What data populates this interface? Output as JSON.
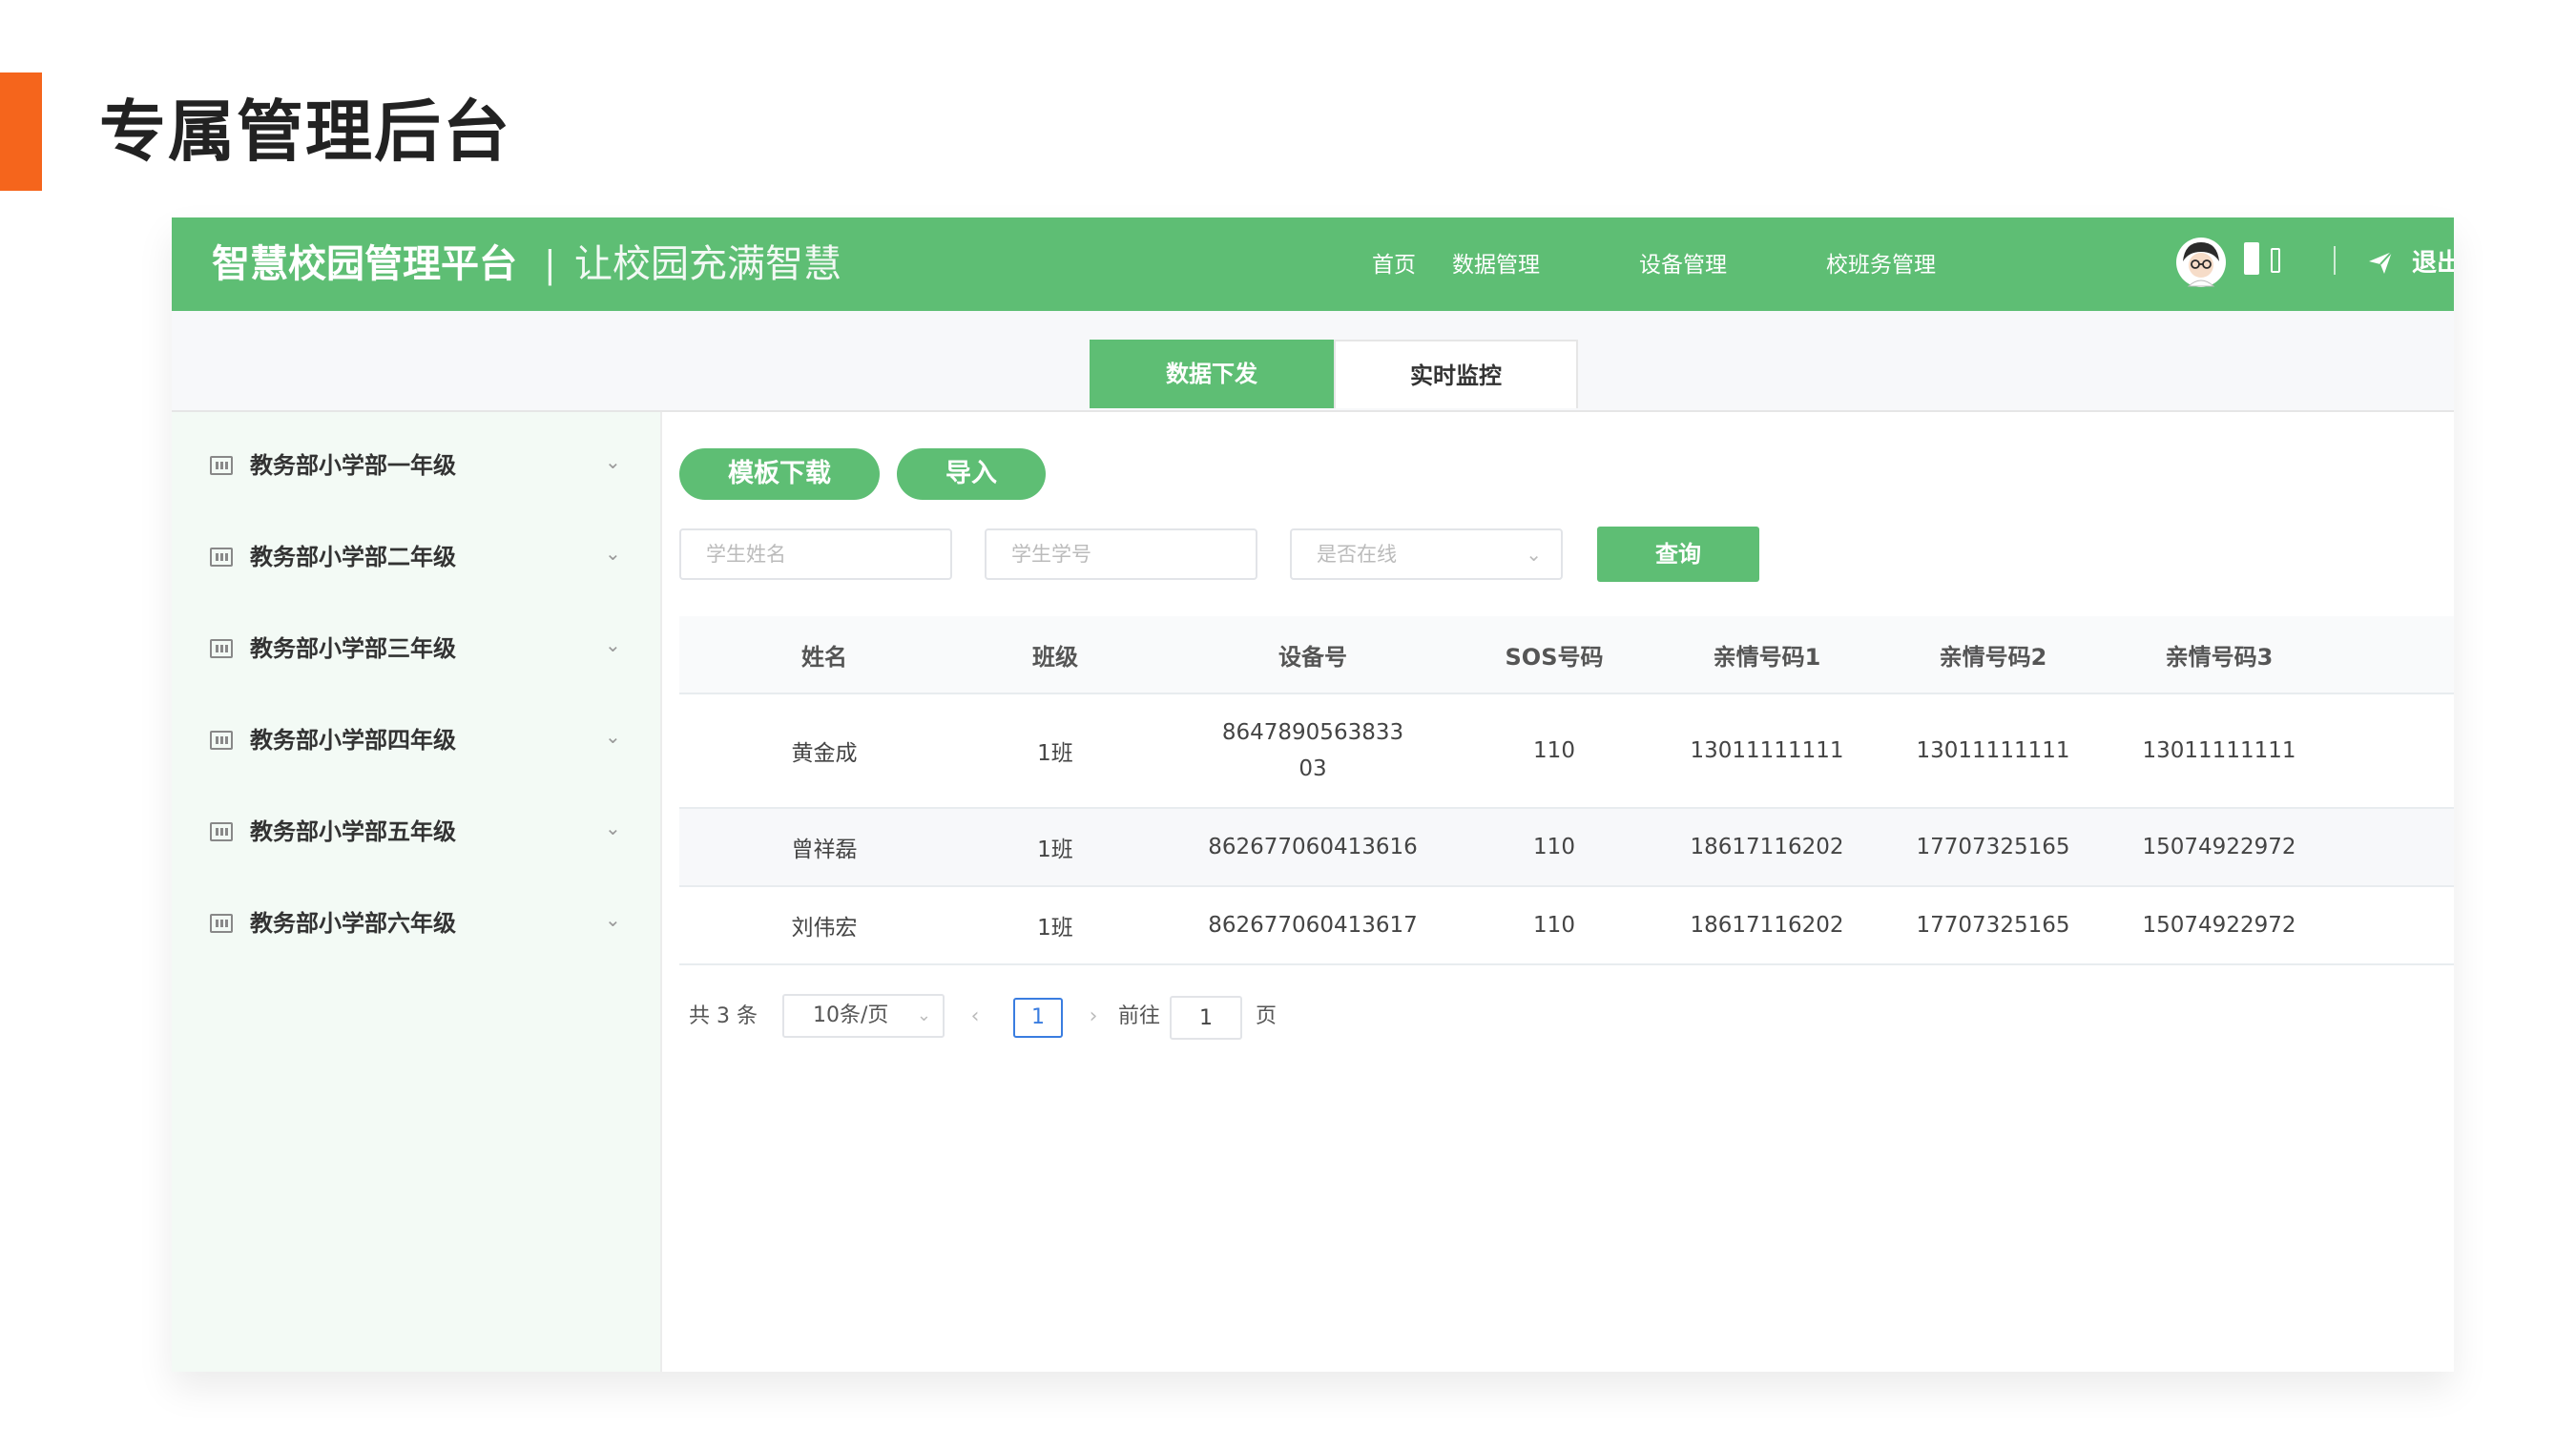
{
  "slide": {
    "title": "专属管理后台"
  },
  "header": {
    "brand": "智慧校园管理平台",
    "separator": "|",
    "slogan": "让校园充满智慧",
    "nav": [
      "首页",
      "数据管理",
      "设备管理",
      "校班务管理"
    ],
    "logout": "退出"
  },
  "tabs": [
    {
      "label": "数据下发",
      "active": true
    },
    {
      "label": "实时监控",
      "active": false
    }
  ],
  "sidebar": {
    "items": [
      {
        "label": "教务部小学部一年级"
      },
      {
        "label": "教务部小学部二年级"
      },
      {
        "label": "教务部小学部三年级"
      },
      {
        "label": "教务部小学部四年级"
      },
      {
        "label": "教务部小学部五年级"
      },
      {
        "label": "教务部小学部六年级"
      }
    ]
  },
  "toolbar": {
    "template_download": "模板下载",
    "import": "导入",
    "name_placeholder": "学生姓名",
    "number_placeholder": "学生学号",
    "online_placeholder": "是否在线",
    "query": "查询"
  },
  "table": {
    "columns": [
      "姓名",
      "班级",
      "设备号",
      "SOS号码",
      "亲情号码1",
      "亲情号码2",
      "亲情号码3"
    ],
    "rows": [
      [
        "黄金成",
        "1班",
        "864789056383303",
        "110",
        "13011111111",
        "13011111111",
        "13011111111"
      ],
      [
        "曾祥磊",
        "1班",
        "862677060413616",
        "110",
        "18617116202",
        "17707325165",
        "15074922972"
      ],
      [
        "刘伟宏",
        "1班",
        "862677060413617",
        "110",
        "18617116202",
        "17707325165",
        "15074922972"
      ]
    ]
  },
  "pagination": {
    "total": "共 3 条",
    "page_size": "10条/页",
    "current_page": "1",
    "goto_label": "前往",
    "goto_value": "1",
    "page_suffix": "页"
  },
  "colors": {
    "accent": "#f5651c",
    "primary_green": "#5ebe74",
    "sidebar_bg": "#f3faf5",
    "pager_active": "#3a7de0"
  },
  "icons": [
    "avatar",
    "send-icon",
    "grid-icon",
    "chevron-down-icon",
    "chevron-left-icon",
    "chevron-right-icon"
  ]
}
